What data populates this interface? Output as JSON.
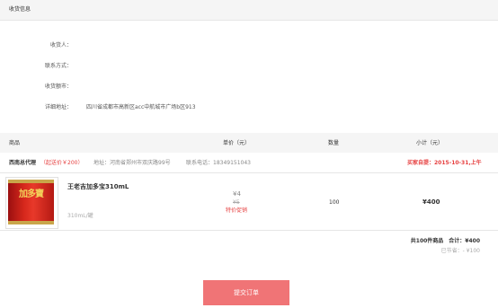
{
  "section": {
    "title": "收货信息"
  },
  "receiver": {
    "name_label": "收货人：",
    "name_value": "",
    "phone_label": "联系方式：",
    "phone_value": "",
    "region_label": "收货额市：",
    "region_value": "",
    "address_label": "详细地址：",
    "address_value": "四川省成都市高新区acc中航城市广场b区913"
  },
  "table": {
    "headers": {
      "product": "商品",
      "unit_price": "单价（元）",
      "quantity": "数量",
      "subtotal": "小计（元）"
    }
  },
  "shop": {
    "name": "西南总代理",
    "min_order": "（起送价￥200）",
    "address": "地址：河南省郑州市双庆路99号",
    "phone": "联系电话：18349151043",
    "pickup": "买家自提：2015-10-31,上午"
  },
  "item": {
    "image_icon": "wanglaoji-can-image",
    "image_brand_text": "加多寶",
    "name": "王老吉加多宝310mL",
    "spec": "310mL/罐",
    "price": "¥4",
    "original_price": "¥5",
    "promo": "特价促销",
    "quantity": "100",
    "subtotal": "¥400"
  },
  "summary": {
    "total_line": "共100件商品　合计：¥400",
    "saved_line": "已节省：- ¥100"
  },
  "actions": {
    "submit_label": "提交订单"
  },
  "colors": {
    "accent_red": "#e64040",
    "button": "#f07476",
    "header_bg": "#f5f5f5"
  }
}
